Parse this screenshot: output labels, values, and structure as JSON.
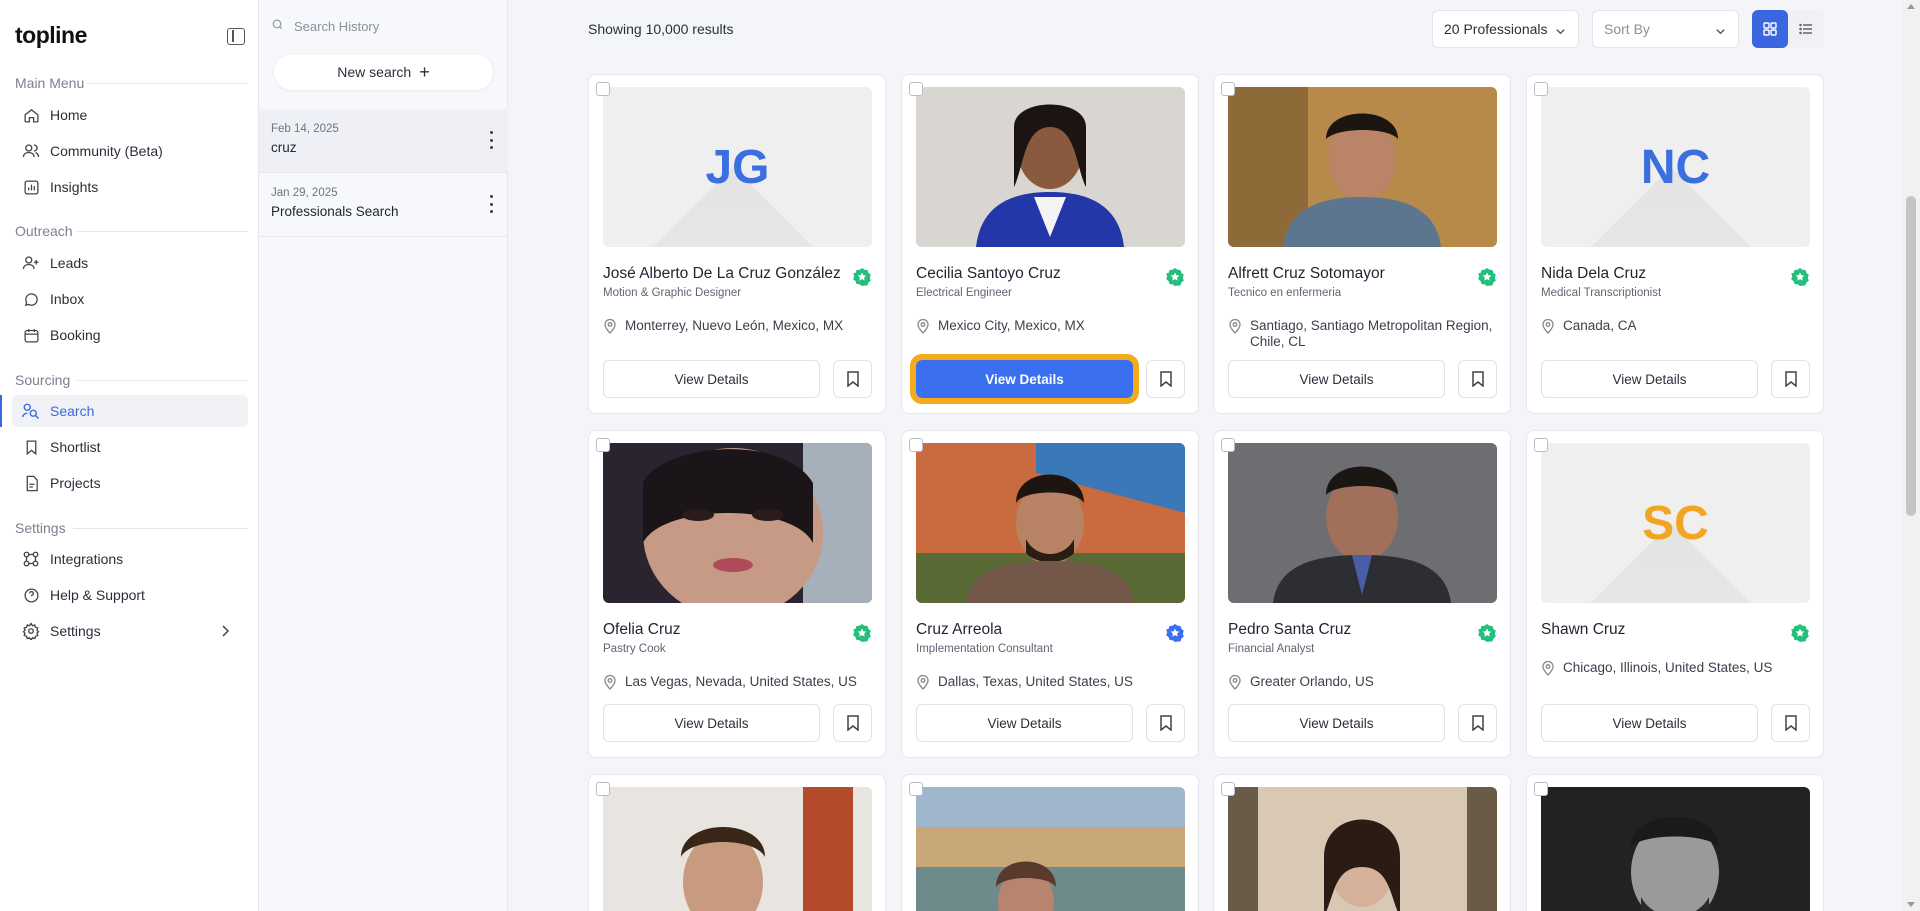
{
  "app": {
    "logo": "topline"
  },
  "nav": {
    "main_menu_label": "Main Menu",
    "home": "Home",
    "community": "Community (Beta)",
    "insights": "Insights",
    "outreach_label": "Outreach",
    "leads": "Leads",
    "inbox": "Inbox",
    "booking": "Booking",
    "sourcing_label": "Sourcing",
    "search": "Search",
    "shortlist": "Shortlist",
    "projects": "Projects",
    "settings_label": "Settings",
    "integrations": "Integrations",
    "help": "Help & Support",
    "settings": "Settings"
  },
  "history": {
    "search_placeholder": "Search History",
    "new_search": "New search",
    "items": [
      {
        "date": "Feb 14, 2025",
        "name": "cruz"
      },
      {
        "date": "Jan 29, 2025",
        "name": "Professionals Search"
      }
    ]
  },
  "toolbar": {
    "results_text": "Showing 10,000 results",
    "page_size": "20 Professionals",
    "sort_placeholder": "Sort By"
  },
  "cards": [
    {
      "name": "José Alberto De La Cruz González",
      "title": "Motion & Graphic Designer",
      "location": "Monterrey, Nuevo León, Mexico, MX",
      "initials": "JG",
      "initials_color": "#3b6fe0",
      "badge": "green",
      "button": "View Details"
    },
    {
      "name": "Cecilia Santoyo Cruz",
      "title": "Electrical Engineer",
      "location": "Mexico City, Mexico, MX",
      "badge": "green",
      "button": "View Details"
    },
    {
      "name": "Alfrett Cruz Sotomayor",
      "title": "Tecnico en enfermeria",
      "location": "Santiago, Santiago Metropolitan Region, Chile, CL",
      "badge": "green",
      "button": "View Details"
    },
    {
      "name": "Nida Dela Cruz",
      "title": "Medical Transcriptionist",
      "location": "Canada, CA",
      "initials": "NC",
      "initials_color": "#3b6fe0",
      "badge": "green",
      "button": "View Details"
    },
    {
      "name": "Ofelia Cruz",
      "title": "Pastry Cook",
      "location": "Las Vegas, Nevada, United States, US",
      "badge": "green",
      "button": "View Details"
    },
    {
      "name": "Cruz Arreola",
      "title": "Implementation Consultant",
      "location": "Dallas, Texas, United States, US",
      "badge": "blue",
      "button": "View Details"
    },
    {
      "name": "Pedro Santa Cruz",
      "title": "Financial Analyst",
      "location": "Greater Orlando, US",
      "badge": "green",
      "button": "View Details"
    },
    {
      "name": "Shawn Cruz",
      "title": "",
      "location": "Chicago, Illinois, United States, US",
      "initials": "SC",
      "initials_color": "#f0a623",
      "badge": "green",
      "button": "View Details"
    }
  ],
  "colors": {
    "accent": "#3a66e0",
    "badge_green": "#22c07a",
    "badge_blue": "#3a6ff0",
    "highlight": "#f3aa1b"
  }
}
